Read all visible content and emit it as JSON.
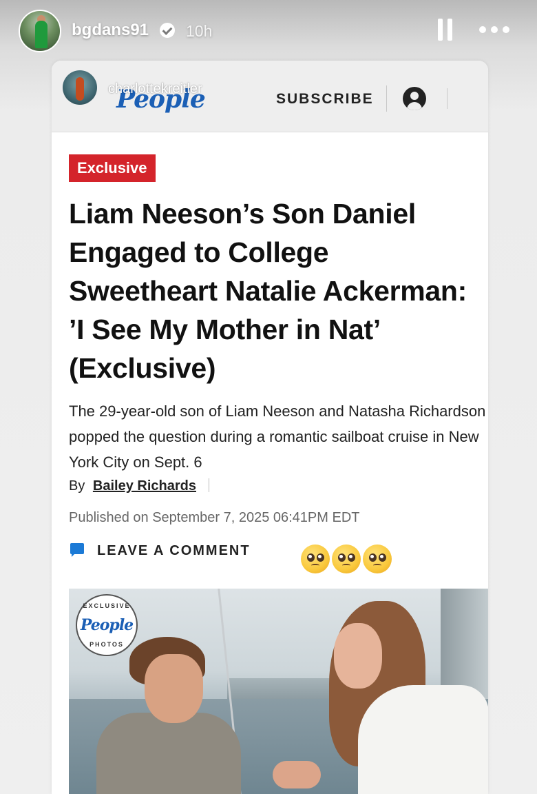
{
  "story": {
    "username": "bgdans91",
    "time": "10h"
  },
  "site": {
    "logo": "People",
    "reposter": "charlottekreitler",
    "subscribe_label": "SUBSCRIBE"
  },
  "article": {
    "badge": "Exclusive",
    "headline": "Liam Neeson’s Son Daniel Engaged to College Sweetheart Natalie Ackerman: ’I See My Mother in Nat’ (Exclusive)",
    "dek": "The 29-year-old son of Liam Neeson and Natasha Richardson popped the question during a romantic sailboat cruise in New York City on Sept. 6",
    "by_label": "By",
    "author": "Bailey Richards",
    "published": "Published on September 7, 2025 06:41PM EDT",
    "comment_label": "LEAVE A COMMENT"
  },
  "photo_badge": {
    "top": "EXCLUSIVE",
    "logo": "People",
    "bottom": "PHOTOS"
  },
  "colors": {
    "badge_red": "#d4242b",
    "link_blue": "#1b7ad6",
    "people_blue": "#1b5fb5"
  },
  "icons": [
    "verified-icon",
    "pause-icon",
    "more-icon",
    "account-icon",
    "comment-icon",
    "pleading-face-emoji"
  ]
}
